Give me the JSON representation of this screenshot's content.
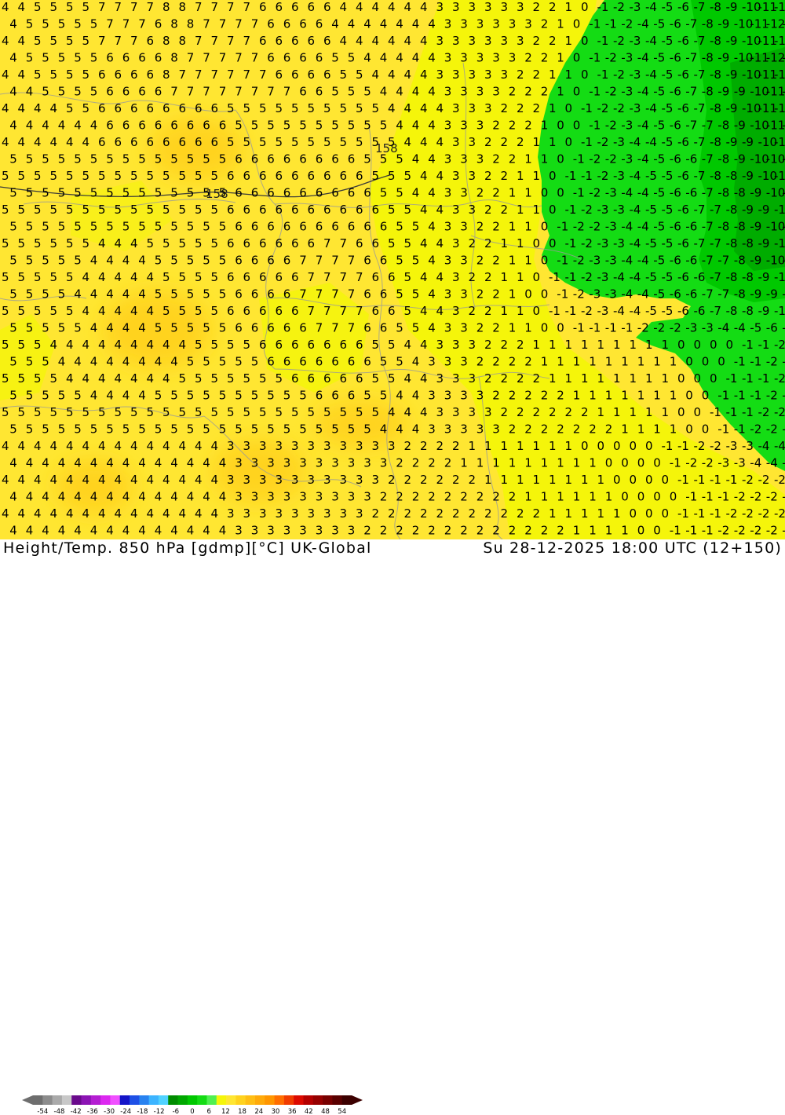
{
  "title": "Height/Temp. 850 hPa [gdmp][°C] UK-Global",
  "valid_time": "Su 28-12-2025 18:00 UTC (12+150)",
  "map": {
    "contour_label": "158",
    "geopotential_labels": [
      "158",
      "158"
    ]
  },
  "legend": {
    "ticks": [
      "-54",
      "-48",
      "-42",
      "-36",
      "-30",
      "-24",
      "-18",
      "-12",
      "-6",
      "0",
      "6",
      "12",
      "18",
      "24",
      "30",
      "36",
      "42",
      "48",
      "54"
    ],
    "colors": [
      "#6e6e6e",
      "#8c8c8c",
      "#aaaaaa",
      "#c8c8c8",
      "#6a0a8c",
      "#8c14b4",
      "#b41ed2",
      "#dc28f0",
      "#f050ff",
      "#1414c8",
      "#1e50e6",
      "#2882f0",
      "#3cb4ff",
      "#50d2ff",
      "#008c00",
      "#00a800",
      "#00c800",
      "#14dc14",
      "#50f050",
      "#f5f50a",
      "#ffe632",
      "#ffd21e",
      "#ffbe14",
      "#ffaa0a",
      "#ff9600",
      "#ff6e00",
      "#f03c00",
      "#dc0a00",
      "#b40000",
      "#960000",
      "#780000",
      "#5a0000",
      "#3c0000"
    ],
    "arrow_left_color": "#6e6e6e",
    "arrow_right_color": "#3c0000"
  }
}
